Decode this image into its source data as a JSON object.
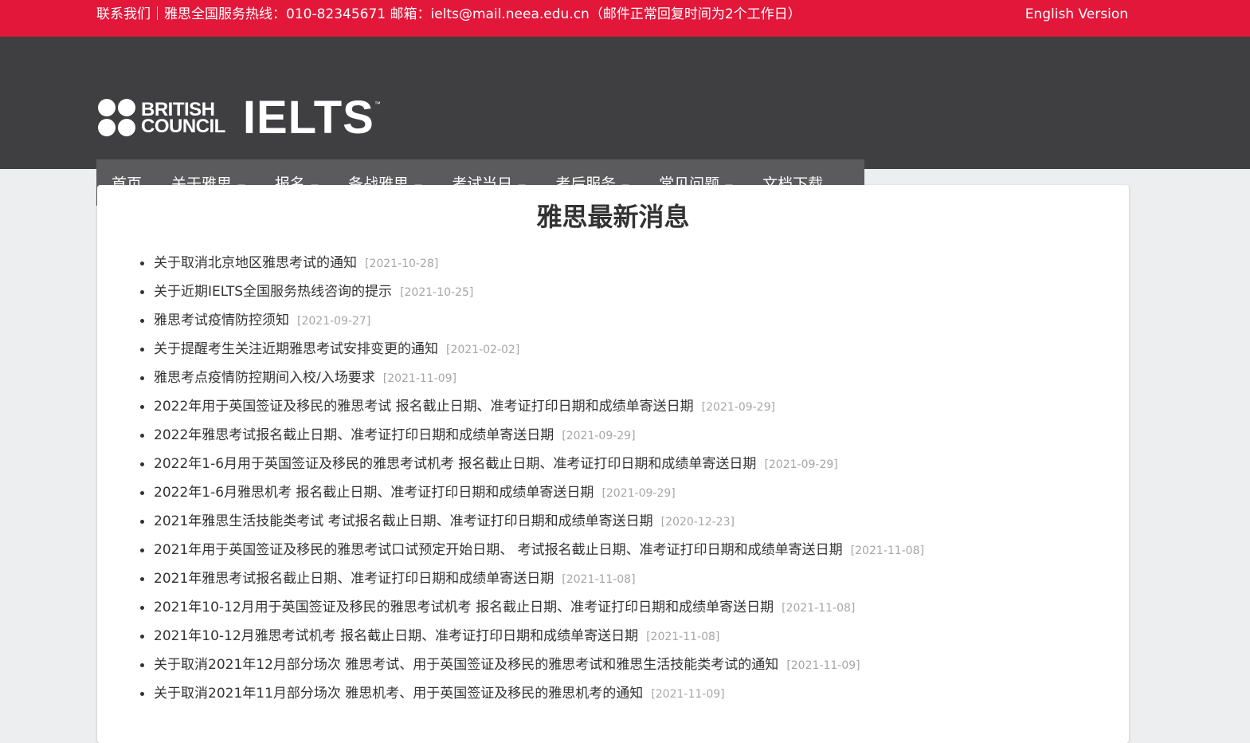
{
  "topbar": {
    "contact": "联系我们｜雅思全国服务热线：010-82345671   邮箱：ielts@mail.neea.edu.cn（邮件正常回复时间为2个工作日）",
    "english_link": "English Version"
  },
  "logo": {
    "bc_line1": "BRITISH",
    "bc_line2": "COUNCIL",
    "ielts": "IELTS",
    "tm": "™"
  },
  "nav": {
    "items": [
      {
        "label": "首页"
      },
      {
        "label": "关于雅思"
      },
      {
        "label": "报名"
      },
      {
        "label": "备战雅思"
      },
      {
        "label": "考试当日"
      },
      {
        "label": "考后服务"
      },
      {
        "label": "常见问题"
      },
      {
        "label": "文档下载"
      }
    ]
  },
  "main": {
    "title": "雅思最新消息",
    "news": [
      {
        "title": "关于取消北京地区雅思考试的通知",
        "date": "[2021-10-28]"
      },
      {
        "title": "关于近期IELTS全国服务热线咨询的提示",
        "date": "[2021-10-25]"
      },
      {
        "title": "雅思考试疫情防控须知",
        "date": "[2021-09-27]"
      },
      {
        "title": "关于提醒考生关注近期雅思考试安排变更的通知",
        "date": "[2021-02-02]"
      },
      {
        "title": "雅思考点疫情防控期间入校/入场要求",
        "date": "[2021-11-09]"
      },
      {
        "title": "2022年用于英国签证及移民的雅思考试 报名截止日期、准考证打印日期和成绩单寄送日期",
        "date": "[2021-09-29]"
      },
      {
        "title": "2022年雅思考试报名截止日期、准考证打印日期和成绩单寄送日期",
        "date": "[2021-09-29]"
      },
      {
        "title": "2022年1-6月用于英国签证及移民的雅思考试机考 报名截止日期、准考证打印日期和成绩单寄送日期",
        "date": "[2021-09-29]"
      },
      {
        "title": "2022年1-6月雅思机考 报名截止日期、准考证打印日期和成绩单寄送日期",
        "date": "[2021-09-29]"
      },
      {
        "title": "2021年雅思生活技能类考试 考试报名截止日期、准考证打印日期和成绩单寄送日期",
        "date": "[2020-12-23]"
      },
      {
        "title": "2021年用于英国签证及移民的雅思考试口试预定开始日期、 考试报名截止日期、准考证打印日期和成绩单寄送日期",
        "date": "[2021-11-08]"
      },
      {
        "title": "2021年雅思考试报名截止日期、准考证打印日期和成绩单寄送日期",
        "date": "[2021-11-08]"
      },
      {
        "title": "2021年10-12月用于英国签证及移民的雅思考试机考 报名截止日期、准考证打印日期和成绩单寄送日期",
        "date": "[2021-11-08]"
      },
      {
        "title": "2021年10-12月雅思考试机考 报名截止日期、准考证打印日期和成绩单寄送日期",
        "date": "[2021-11-08]"
      },
      {
        "title": "关于取消2021年12月部分场次 雅思考试、用于英国签证及移民的雅思考试和雅思生活技能类考试的通知",
        "date": "[2021-11-09]"
      },
      {
        "title": "关于取消2021年11月部分场次 雅思机考、用于英国签证及移民的雅思机考的通知",
        "date": "[2021-11-09]"
      }
    ]
  }
}
